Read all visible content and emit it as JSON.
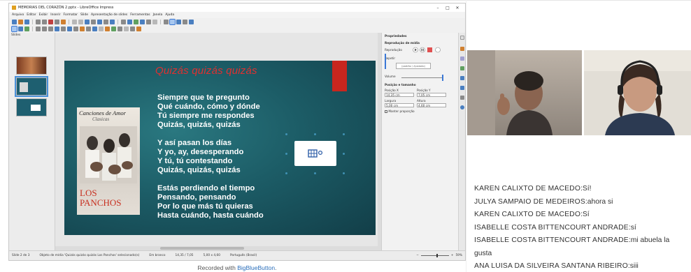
{
  "window": {
    "title": "MEMORIAS DEL CORAZÓN 2.pptx - LibreOffice Impress",
    "controls": [
      "–",
      "□",
      "✕"
    ]
  },
  "menu": [
    "Arquivo",
    "Editar",
    "Exibir",
    "Inserir",
    "Formatar",
    "Slide",
    "Apresentação de slides",
    "Ferramentas",
    "Janela",
    "Ajuda"
  ],
  "slides_panel": {
    "header": "Slides"
  },
  "slide": {
    "title": "Quizás quizás quizás",
    "lyrics": [
      "Siempre que te pregunto",
      "Qué cuándo, cómo y dónde",
      "Tú siempre me respondes",
      "Quizás, quizás, quizás",
      "",
      "Y así pasan los días",
      "Y yo, ay, desesperando",
      "Y tú, tú contestando",
      "Quizás, quizás, quizás",
      "",
      "Estás perdiendo el tiempo",
      "Pensando, pensando",
      "Por lo que más tú quieras",
      "Hasta cuándo, hasta cuándo"
    ],
    "album": {
      "title": "Canciones de Amor",
      "subtitle": "Clasicas",
      "artist_line1": "LOS",
      "artist_line2": "PANCHOS"
    }
  },
  "properties": {
    "header": "Propriedades",
    "media_section": "Reprodução de mídia",
    "playback_label": "Reprodução",
    "repeat_label": "Repetir",
    "volume_label": "Volume",
    "position_section": "Posição e tamanho",
    "pos_x_label": "Posição X",
    "pos_y_label": "Posição Y",
    "pos_x": "14,35 cm",
    "pos_y": "7,05 cm",
    "width_label": "Largura",
    "height_label": "Altura",
    "width": "5,00 cm",
    "height": "4,60 cm",
    "keep_ratio": "Manter proporção",
    "ratio_hint": "(padrão / Ajustado)"
  },
  "statusbar": {
    "slide_info": "Slide 2 de 3",
    "selection": "Objeto de mídia 'Quizás quizás quizás Los Panchos' selecionado(s)",
    "master": "Em branco",
    "position": "14,35 / 7,05",
    "size": "5,00 x 4,60",
    "language": "Português (Brasil)",
    "zoom": "59%"
  },
  "recorded": {
    "prefix": "Recorded with ",
    "link": "BigBlueButton",
    "suffix": "."
  },
  "chat": [
    {
      "name": "KAREN CALIXTO DE MACEDO",
      "text": "Sí!"
    },
    {
      "name": "JULYA SAMPAIO DE MEDEIROS",
      "text": "ahora si"
    },
    {
      "name": "KAREN CALIXTO DE MACEDO",
      "text": "Sí"
    },
    {
      "name": "ISABELLE COSTA BITTENCOURT ANDRADE",
      "text": "sí"
    },
    {
      "name": "ISABELLE COSTA BITTENCOURT ANDRADE",
      "text": "mi abuela la gusta"
    },
    {
      "name": "ANA LUISA DA SILVEIRA SANTANA RIBEIRO",
      "text": "siii"
    }
  ],
  "colors": {
    "slide_bg": "#1c5c66",
    "title_red": "#e03030",
    "accent_rect": "#c8261e",
    "link_blue": "#2a6ebb"
  },
  "icons": [
    "app-icon",
    "media-film-icon",
    "minimize-icon",
    "maximize-icon",
    "close-icon"
  ]
}
